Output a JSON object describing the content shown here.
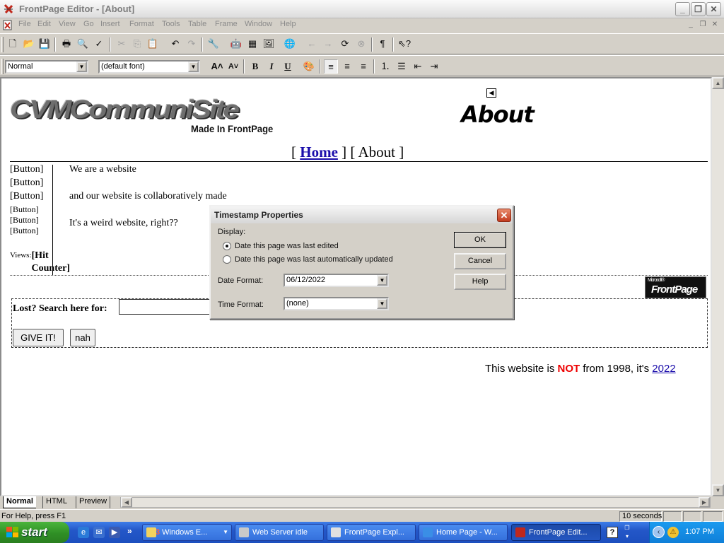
{
  "window": {
    "title": "FrontPage Editor - [About]"
  },
  "menu": [
    "File",
    "Edit",
    "View",
    "Go",
    "Insert",
    "Format",
    "Tools",
    "Table",
    "Frame",
    "Window",
    "Help"
  ],
  "format_toolbar": {
    "style_value": "Normal",
    "font_value": "(default font)"
  },
  "page": {
    "logo_text": "CVMCommuniSite",
    "logo_subtitle": "Made In FrontPage",
    "heading": "About",
    "nav": {
      "open1": "[ ",
      "home": "Home",
      "mid": " ] [ ",
      "about": "About",
      "close": " ]"
    },
    "buttons": [
      "[Button]",
      "[Button]",
      "[Button]",
      "[Button]",
      "[Button]",
      "[Button]"
    ],
    "lines": [
      "We are a website",
      "and our website is collaboratively made",
      "It's a weird website, right??"
    ],
    "views_label": "Views:",
    "hit_counter": "[Hit Counter]",
    "badge": {
      "small": "Microsoft®",
      "big": "FrontPage"
    },
    "search_label": "Lost? Search here for:",
    "submit_label": "GIVE IT!",
    "reset_label": "nah",
    "footer": {
      "pre": "This website is ",
      "not": "NOT",
      "mid": " from 1998, it's ",
      "year": "2022"
    }
  },
  "view_tabs": [
    "Normal",
    "HTML",
    "Preview"
  ],
  "status": {
    "help_text": "For Help, press F1",
    "download_time": "10 seconds"
  },
  "dialog": {
    "title": "Timestamp Properties",
    "display_label": "Display:",
    "option_edited": "Date this page was last edited",
    "option_updated": "Date this page was last automatically updated",
    "selected_option": "edited",
    "date_format_label": "Date Format:",
    "date_format_value": "06/12/2022",
    "time_format_label": "Time Format:",
    "time_format_value": "(none)",
    "ok": "OK",
    "cancel": "Cancel",
    "help": "Help"
  },
  "taskbar": {
    "start": "start",
    "tasks": [
      {
        "label": "Windows E...",
        "badge": "3"
      },
      {
        "label": "Web Server idle"
      },
      {
        "label": "FrontPage Expl..."
      },
      {
        "label": "Home Page - W..."
      },
      {
        "label": "FrontPage Edit..."
      }
    ],
    "clock": "1:07 PM"
  },
  "colors": {
    "link": "#1a0dab",
    "not_red": "#e00000",
    "taskbar_blue": "#2457c8",
    "start_green": "#3a9a2e"
  }
}
